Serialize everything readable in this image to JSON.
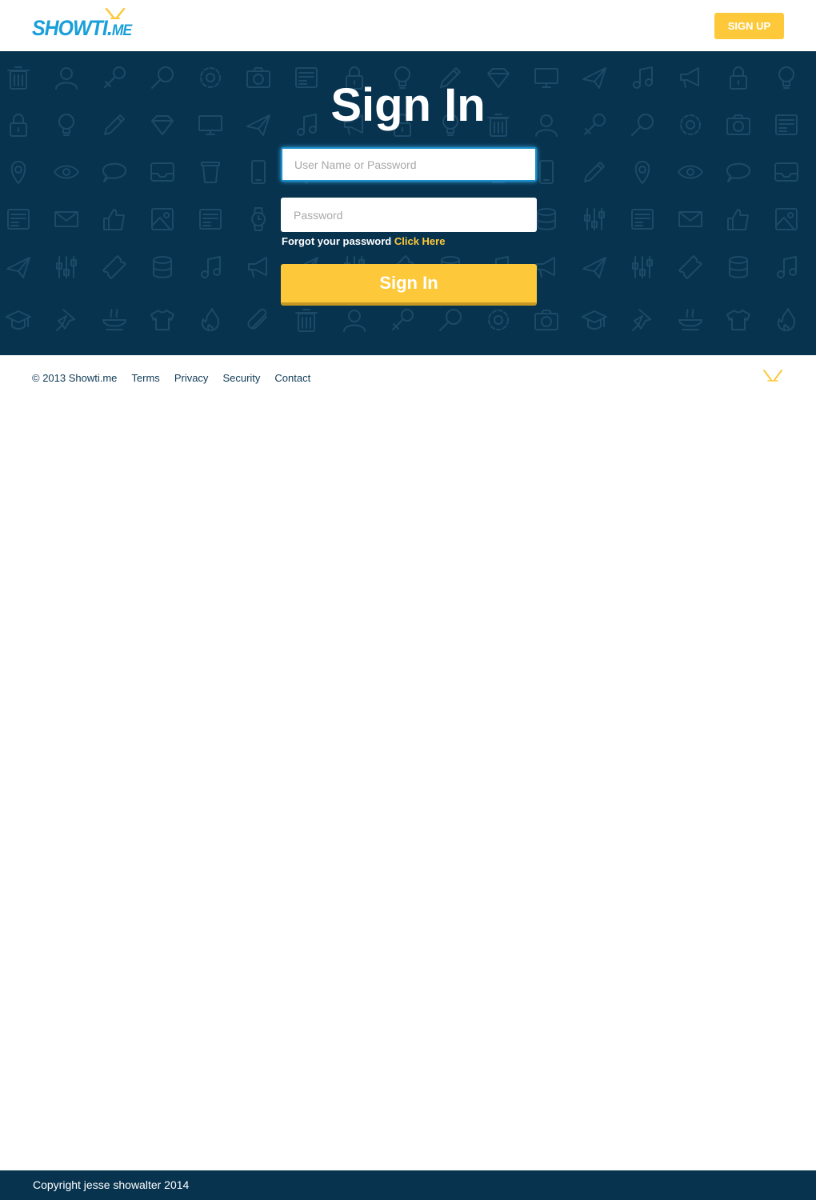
{
  "header": {
    "logo_main": "SHOWTI.",
    "logo_suffix": "ME",
    "signup_label": "SIGN UP"
  },
  "hero": {
    "title": "Sign In",
    "username_placeholder": "User Name or Password",
    "password_placeholder": "Password",
    "forgot_text": "Forgot your password",
    "forgot_link": "Click Here",
    "signin_label": "Sign In"
  },
  "footer": {
    "copyright": "© 2013 Showti.me",
    "links": [
      "Terms",
      "Privacy",
      "Security",
      "Contact"
    ]
  },
  "bottom_bar": {
    "text": "Copyright jesse showalter 2014"
  },
  "colors": {
    "brand_blue": "#1a9fd9",
    "navy": "#07334f",
    "accent_yellow": "#fdc93a"
  },
  "icons": [
    "trash-icon",
    "user-icon",
    "key-icon",
    "search-icon",
    "gear-icon",
    "camera-icon",
    "newspaper-icon",
    "lock-icon",
    "bulb-icon",
    "pencil-icon",
    "diamond-icon",
    "monitor-icon",
    "paper-plane-icon",
    "music-icon",
    "megaphone-icon",
    "map-pin-icon",
    "eye-icon",
    "chat-icon",
    "inbox-icon",
    "cup-icon",
    "phone-icon",
    "mail-icon",
    "thumbs-up-icon",
    "image-icon",
    "watch-icon",
    "sliders-icon",
    "ticket-icon",
    "database-icon",
    "grad-cap-icon",
    "pin-icon",
    "bowl-icon",
    "shirt-icon",
    "flame-icon",
    "paperclip-icon"
  ]
}
